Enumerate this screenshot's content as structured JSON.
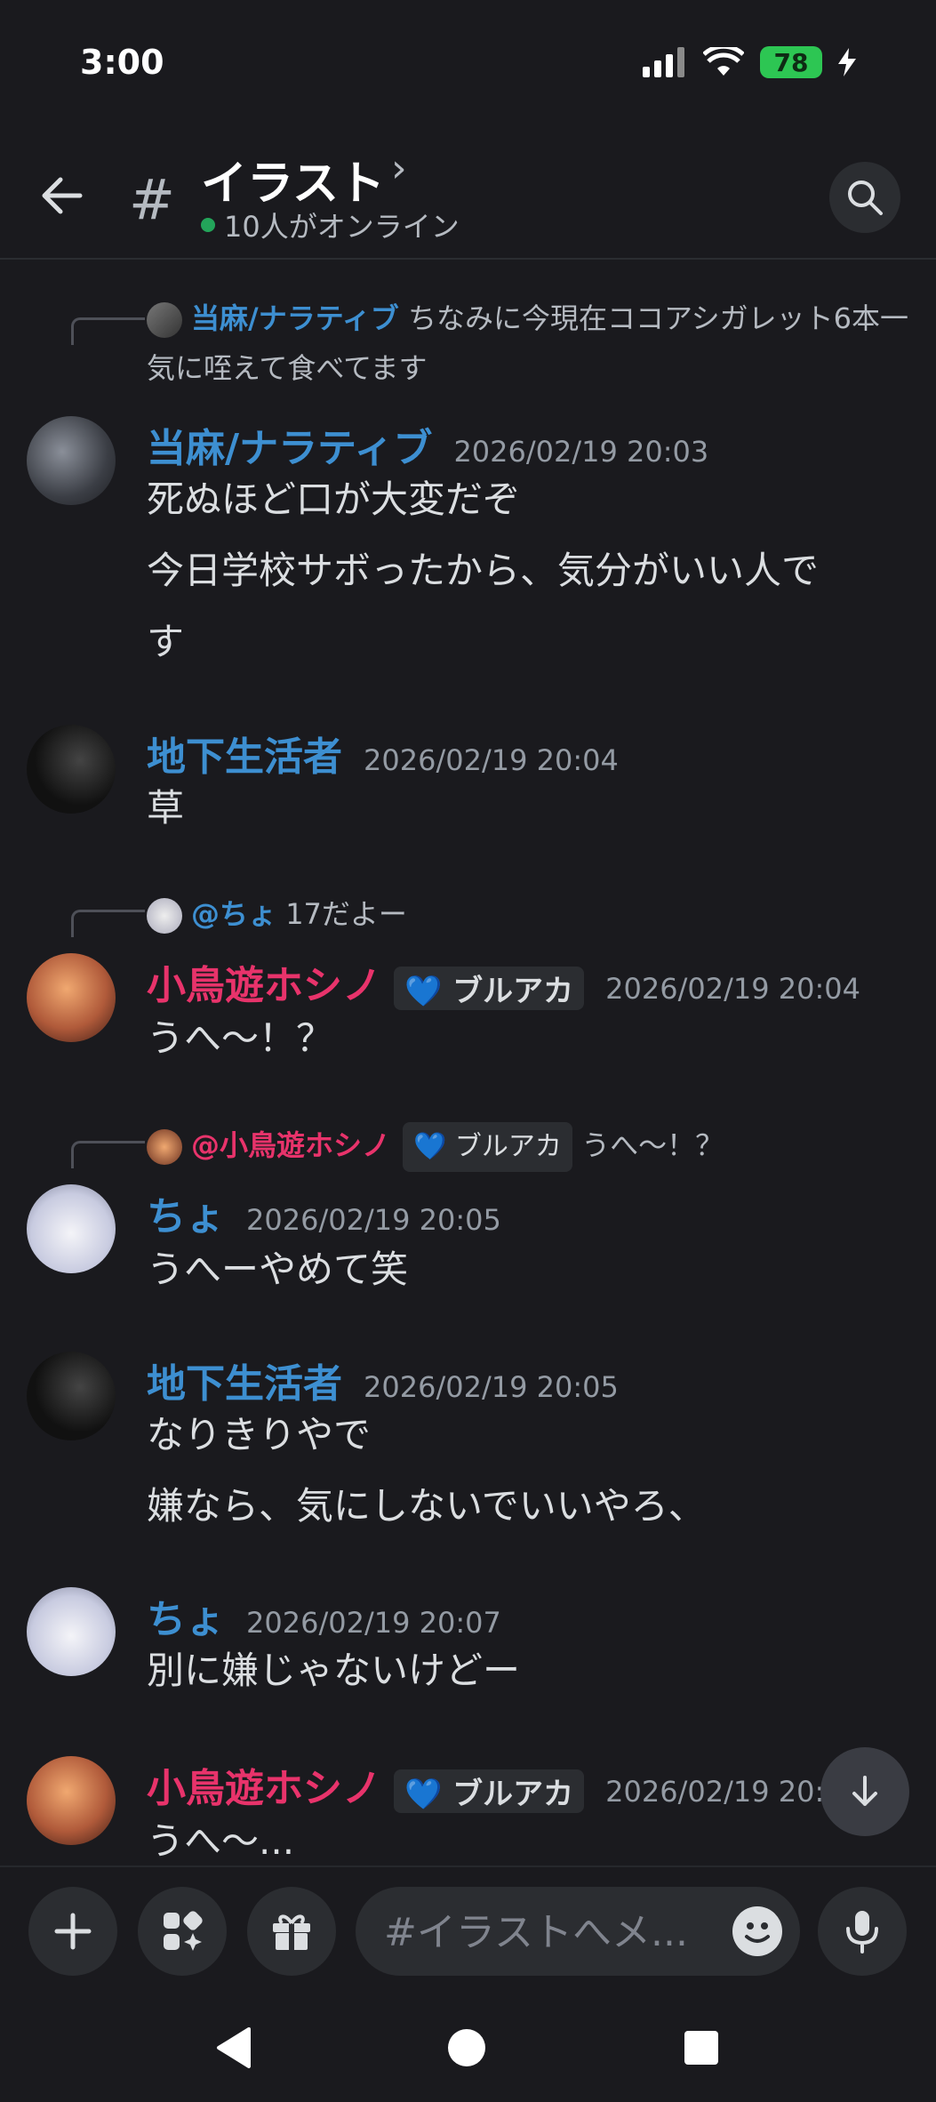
{
  "status_bar": {
    "time": "3:00",
    "battery": "78"
  },
  "header": {
    "hash": "#",
    "channel": "イラスト",
    "chevron": "›",
    "online": "10人がオンライン"
  },
  "messages": [
    {
      "reply_name": "当麻/ナラティブ",
      "reply_text": "ちなみに今現在ココアシガレット6本一気に咥えて食べてます",
      "name": "当麻/ナラティブ",
      "ts": "2026/02/19 20:03",
      "lines": [
        "死ぬほど口が大変だぞ",
        "今日学校サボったから、気分がいい人で",
        "す"
      ]
    },
    {
      "name": "地下生活者",
      "ts": "2026/02/19 20:04",
      "lines": [
        "草"
      ]
    },
    {
      "reply_name": "@ちょ",
      "reply_text": "17だよー",
      "name": "小鳥遊ホシノ",
      "tag": "ブルアカ",
      "ts": "2026/02/19 20:04",
      "lines": [
        "うへ～！？"
      ]
    },
    {
      "reply_name": "@小鳥遊ホシノ",
      "reply_tag": "ブルアカ",
      "reply_text": "うへ～！？",
      "name": "ちょ",
      "ts": "2026/02/19 20:05",
      "lines": [
        "うへーやめて笑"
      ]
    },
    {
      "name": "地下生活者",
      "ts": "2026/02/19 20:05",
      "lines": [
        "なりきりやで",
        "嫌なら、気にしないでいいやろ、"
      ]
    },
    {
      "name": "ちょ",
      "ts": "2026/02/19 20:07",
      "lines": [
        "別に嫌じゃないけどー"
      ]
    },
    {
      "name": "小鳥遊ホシノ",
      "tag": "ブルアカ",
      "ts": "2026/02/19 20:0",
      "lines": [
        "うへ～..."
      ]
    }
  ],
  "composer": {
    "placeholder": "#イラストへメ..."
  },
  "colors": {
    "name_blue": "#3d8fd1",
    "name_pink": "#e8336b",
    "online": "#23a55a"
  }
}
